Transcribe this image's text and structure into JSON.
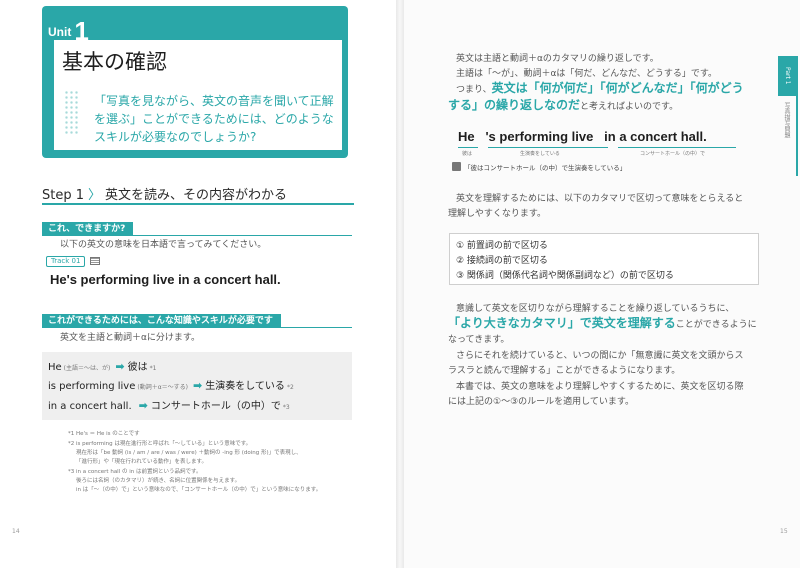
{
  "left_page": {
    "unit_word": "Unit",
    "unit_number": "1",
    "unit_title": "基本の確認",
    "unit_question": "「写真を見ながら、英文の音声を聞いて正解を選ぶ」ことができるためには、どのようなスキルが必要なのでしょうか?",
    "step_label": "Step 1",
    "step_title": "英文を読み、その内容がわかる",
    "can_you_label": "これ、できますか?",
    "can_you_text": "以下の英文の意味を日本語で言ってみてください。",
    "track_label": "Track 01",
    "sentence": "He's performing live in a concert hall.",
    "needs_label": "これができるためには、こんな知識やスキルが必要です",
    "needs_text": "英文を主語と動詞＋αに分けます。",
    "rows": [
      {
        "en": "He",
        "note": "(主語＝〜は、が)",
        "ja": "彼は",
        "sup": "*1"
      },
      {
        "en": "is performing live",
        "note": "(動詞＋α＝〜する)",
        "ja": "生演奏をしている",
        "sup": "*2"
      },
      {
        "en": "in a concert hall.",
        "note": "",
        "ja": "コンサートホール（の中）で",
        "sup": "*3"
      }
    ],
    "footnotes": [
      "*1 He's ＝ He is のことです",
      "*2 is performing は現在進行形と呼ばれ「〜している」という意味です。",
      "現在形は「be 動詞 (is / am / are / was / were) ＋動詞の -ing 形 (doing 形)」で表現し、",
      "「進行形」や「現在行われている動作」を表します。",
      "*3 in a concert hall の in は前置詞という品詞です。",
      "後ろには名詞（のカタマリ）が続き、名詞に位置関係を与えます。",
      "in は「〜（の中）で」という意味なので、「コンサートホール（の中）で」という意味になります。"
    ],
    "page_number": "14"
  },
  "right_page": {
    "p1_line1": "英文は主語と動詞＋αのカタマリの繰り返しです。",
    "p1_line2": "主語は「〜が」、動詞＋αは「何だ、どんなだ、どうする」です。",
    "p1_line3_a": "つまり、",
    "p1_line3_b": "英文は「何が何だ」「何がどんなだ」「何がどう",
    "p1_line4_a": "する」の繰り返しなのだ",
    "p1_line4_b": "と考えればよいのです。",
    "sentence_parts": [
      "He",
      "'s performing live",
      "in a concert hall."
    ],
    "sentence_labels": [
      "彼は",
      "生演奏をしている",
      "コンサートホール（の中）で"
    ],
    "translation": "「彼はコンサートホール（の中）で生演奏をしている」",
    "p2_line1": "英文を理解するためには、以下のカタマリで区切って意味をとらえると",
    "p2_line2": "理解しやすくなります。",
    "rules": [
      "① 前置詞の前で区切る",
      "② 接続詞の前で区切る",
      "③ 関係詞（関係代名詞や関係副詞など）の前で区切る"
    ],
    "p3_line1": "意識して英文を区切りながら理解することを繰り返しているうちに、",
    "p3_line2_a": "「より大きなカタマリ」で英文を理解する",
    "p3_line2_b": "ことができるように",
    "p3_line3": "なってきます。",
    "p3_line4": "さらにそれを続けていると、いつの間にか「無意識に英文を文頭からス",
    "p3_line5": "ラスラと読んで理解する」ことができるようになります。",
    "p3_line6": "本書では、英文の意味をより理解しやすくするために、英文を区切る際",
    "p3_line7": "には上記の①〜③のルールを適用しています。",
    "side_tab": "Part 1",
    "side_text": "写真描写問題",
    "page_number": "15"
  },
  "colors": {
    "accent": "#2aa7a8",
    "text": "#3a3a3a",
    "gray_box": "#efefef"
  }
}
